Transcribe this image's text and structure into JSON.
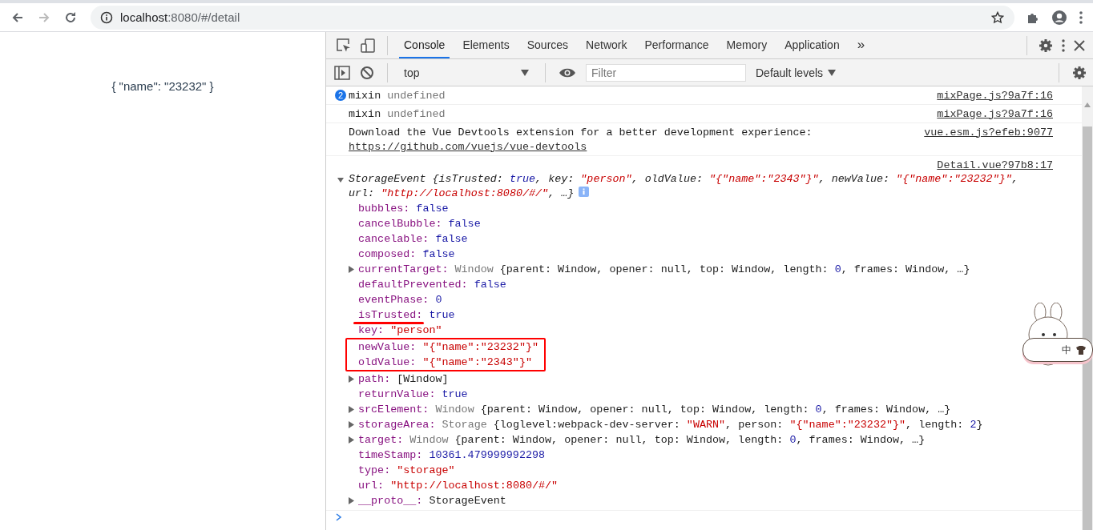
{
  "browser": {
    "url_host": "localhost",
    "url_rest": ":8080/#/detail"
  },
  "page": {
    "text": "{ \"name\": \"23232\" }"
  },
  "devtools": {
    "tabs": [
      {
        "label": "Console",
        "selected": true
      },
      {
        "label": "Elements",
        "selected": false
      },
      {
        "label": "Sources",
        "selected": false
      },
      {
        "label": "Network",
        "selected": false
      },
      {
        "label": "Performance",
        "selected": false
      },
      {
        "label": "Memory",
        "selected": false
      },
      {
        "label": "Application",
        "selected": false
      }
    ],
    "more_tabs": "»",
    "context": "top",
    "filter": {
      "placeholder": "Filter"
    },
    "levels": "Default levels",
    "messages": [
      {
        "kind": "log",
        "count": "2",
        "tokens": [
          {
            "kind": "plain",
            "text": "mixin"
          },
          {
            "kind": "class",
            "text": " undefined"
          }
        ],
        "source": "mixPage.js?9a7f:16"
      },
      {
        "kind": "log",
        "tokens": [
          {
            "kind": "plain",
            "text": "mixin"
          },
          {
            "kind": "class",
            "text": " undefined"
          }
        ],
        "source": "mixPage.js?9a7f:16"
      },
      {
        "kind": "log",
        "tokens": [
          {
            "kind": "plain",
            "text": "Download the Vue Devtools extension for a better development experience:"
          }
        ],
        "link": "https://github.com/vuejs/vue-devtools",
        "source": "vue.esm.js?efeb:9077"
      },
      {
        "kind": "object",
        "source": "Detail.vue?97b8:17",
        "expanded": true,
        "header": [
          {
            "kind": "plain",
            "text": "StorageEvent {isTrusted: "
          },
          {
            "kind": "keyword",
            "text": "true"
          },
          {
            "kind": "plain",
            "text": ", key: "
          },
          {
            "kind": "string",
            "text": "\"person\""
          },
          {
            "kind": "plain",
            "text": ", oldValue: "
          },
          {
            "kind": "string",
            "text": "\"{\"name\":\"2343\"}\""
          },
          {
            "kind": "plain",
            "text": ", newValue: "
          },
          {
            "kind": "string",
            "text": "\"{\"name\":\"23232\"}\""
          },
          {
            "kind": "plain",
            "text": ", url: "
          },
          {
            "kind": "string",
            "text": "\"http://localhost:8080/#/\""
          },
          {
            "kind": "plain",
            "text": ", …}"
          }
        ],
        "properties": [
          {
            "name": "bubbles:",
            "expandable": false,
            "underlined": false,
            "boxed": false,
            "value": [
              {
                "kind": "keyword",
                "text": "false"
              }
            ]
          },
          {
            "name": "cancelBubble:",
            "expandable": false,
            "underlined": false,
            "boxed": false,
            "value": [
              {
                "kind": "keyword",
                "text": "false"
              }
            ]
          },
          {
            "name": "cancelable:",
            "expandable": false,
            "underlined": false,
            "boxed": false,
            "value": [
              {
                "kind": "keyword",
                "text": "false"
              }
            ]
          },
          {
            "name": "composed:",
            "expandable": false,
            "underlined": false,
            "boxed": false,
            "value": [
              {
                "kind": "keyword",
                "text": "false"
              }
            ]
          },
          {
            "name": "currentTarget:",
            "expandable": true,
            "underlined": false,
            "boxed": false,
            "value": [
              {
                "kind": "class",
                "text": "Window"
              },
              {
                "kind": "plain",
                "text": " {parent: Window, opener: null, top: Window, length: "
              },
              {
                "kind": "keyword",
                "text": "0"
              },
              {
                "kind": "plain",
                "text": ", frames: Window, …}"
              }
            ]
          },
          {
            "name": "defaultPrevented:",
            "expandable": false,
            "underlined": false,
            "boxed": false,
            "value": [
              {
                "kind": "keyword",
                "text": "false"
              }
            ]
          },
          {
            "name": "eventPhase:",
            "expandable": false,
            "underlined": false,
            "boxed": false,
            "value": [
              {
                "kind": "keyword",
                "text": "0"
              }
            ]
          },
          {
            "name": "isTrusted:",
            "expandable": false,
            "underlined": true,
            "boxed": false,
            "value": [
              {
                "kind": "keyword",
                "text": "true"
              }
            ]
          },
          {
            "name": "key:",
            "expandable": false,
            "underlined": false,
            "boxed": false,
            "value": [
              {
                "kind": "string",
                "text": "\"person\""
              }
            ]
          },
          {
            "name": "newValue:",
            "expandable": false,
            "underlined": false,
            "boxed": true,
            "value": [
              {
                "kind": "string",
                "text": "\"{\"name\":\"23232\"}\""
              }
            ]
          },
          {
            "name": "oldValue:",
            "expandable": false,
            "underlined": false,
            "boxed": true,
            "value": [
              {
                "kind": "string",
                "text": "\"{\"name\":\"2343\"}\""
              }
            ]
          },
          {
            "name": "path:",
            "expandable": true,
            "underlined": false,
            "boxed": false,
            "value": [
              {
                "kind": "plain",
                "text": "[Window]"
              }
            ]
          },
          {
            "name": "returnValue:",
            "expandable": false,
            "underlined": false,
            "boxed": false,
            "value": [
              {
                "kind": "keyword",
                "text": "true"
              }
            ]
          },
          {
            "name": "srcElement:",
            "expandable": true,
            "underlined": false,
            "boxed": false,
            "value": [
              {
                "kind": "class",
                "text": "Window"
              },
              {
                "kind": "plain",
                "text": " {parent: Window, opener: null, top: Window, length: "
              },
              {
                "kind": "keyword",
                "text": "0"
              },
              {
                "kind": "plain",
                "text": ", frames: Window, …}"
              }
            ]
          },
          {
            "name": "storageArea:",
            "expandable": true,
            "underlined": false,
            "boxed": false,
            "value": [
              {
                "kind": "class",
                "text": "Storage"
              },
              {
                "kind": "plain",
                "text": " {loglevel:webpack-dev-server: "
              },
              {
                "kind": "string",
                "text": "\"WARN\""
              },
              {
                "kind": "plain",
                "text": ", person: "
              },
              {
                "kind": "string",
                "text": "\"{\"name\":\"23232\"}\""
              },
              {
                "kind": "plain",
                "text": ", length: "
              },
              {
                "kind": "keyword",
                "text": "2"
              },
              {
                "kind": "plain",
                "text": "}"
              }
            ]
          },
          {
            "name": "target:",
            "expandable": true,
            "underlined": false,
            "boxed": false,
            "value": [
              {
                "kind": "class",
                "text": "Window"
              },
              {
                "kind": "plain",
                "text": " {parent: Window, opener: null, top: Window, length: "
              },
              {
                "kind": "keyword",
                "text": "0"
              },
              {
                "kind": "plain",
                "text": ", frames: Window, …}"
              }
            ]
          },
          {
            "name": "timeStamp:",
            "expandable": false,
            "underlined": false,
            "boxed": false,
            "value": [
              {
                "kind": "keyword",
                "text": "10361.479999992298"
              }
            ]
          },
          {
            "name": "type:",
            "expandable": false,
            "underlined": false,
            "boxed": false,
            "value": [
              {
                "kind": "string",
                "text": "\"storage\""
              }
            ]
          },
          {
            "name": "url:",
            "expandable": false,
            "underlined": false,
            "boxed": false,
            "value": [
              {
                "kind": "string",
                "text": "\"http://localhost:8080/#/\""
              }
            ]
          },
          {
            "name": "__proto__:",
            "expandable": true,
            "underlined": false,
            "boxed": false,
            "value": [
              {
                "kind": "plain",
                "text": "StorageEvent"
              }
            ]
          }
        ]
      }
    ]
  },
  "sticker": {
    "label": "中"
  }
}
